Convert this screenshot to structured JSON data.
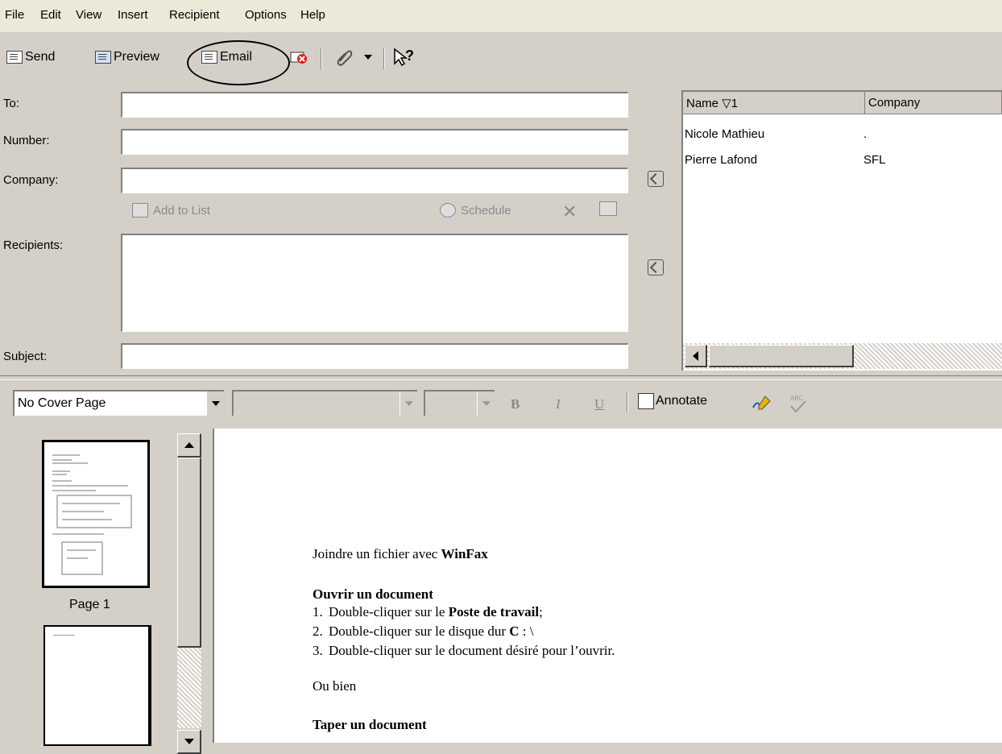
{
  "menu": [
    "File",
    "Edit",
    "View",
    "Insert",
    "Recipient",
    "Options",
    "Help"
  ],
  "toolbar": {
    "send": "Send",
    "preview": "Preview",
    "email": "Email"
  },
  "form": {
    "to_label": "To:",
    "number_label": "Number:",
    "company_label": "Company:",
    "recipients_label": "Recipients:",
    "subject_label": "Subject:",
    "add_to_list": "Add to List",
    "schedule": "Schedule",
    "to_value": "",
    "number_value": "",
    "company_value": "",
    "subject_value": ""
  },
  "contacts": {
    "headers": {
      "name": "Name ▽1",
      "company": "Company"
    },
    "rows": [
      {
        "name": "Nicole Mathieu",
        "company": "."
      },
      {
        "name": "Pierre Lafond",
        "company": "SFL"
      }
    ]
  },
  "format": {
    "cover_page": "No Cover Page",
    "bold": "B",
    "italic": "I",
    "underline": "U",
    "annotate": "Annotate"
  },
  "thumbnails": {
    "page1_label": "Page 1"
  },
  "document": {
    "title_prefix": "Joindre un fichier avec ",
    "title_bold": "WinFax",
    "heading1": "Ouvrir un document",
    "step1_num": "1.",
    "step1_pre": "Double-cliquer sur le ",
    "step1_bold": "Poste de travail",
    "step1_post": ";",
    "step2_num": "2.",
    "step2_pre": "Double-cliquer sur le disque dur ",
    "step2_bold": "C",
    "step2_post": " : \\",
    "step3_num": "3.",
    "step3_text": "Double-cliquer sur le document désiré pour l’ouvrir.",
    "or": "Ou bien",
    "heading2": "Taper un document"
  }
}
